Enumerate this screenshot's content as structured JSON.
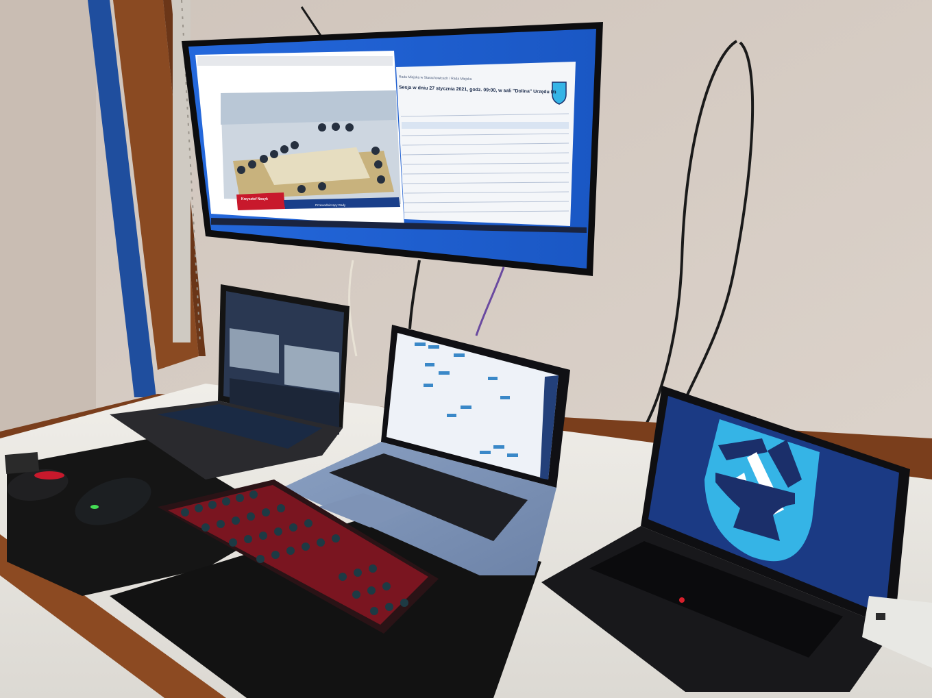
{
  "scene": {
    "description_tags": [
      "desk",
      "monitor",
      "laptop",
      "keyboard",
      "mouse",
      "coat-of-arms"
    ],
    "colors": {
      "wall": "#d9cfc7",
      "desk": "#e9e7e2",
      "screen_blue": "#1e63d6",
      "coat_of_arms_light": "#35b4e6",
      "coat_of_arms_dark": "#1b2f6a",
      "keyboard_accent": "#c8192c"
    }
  },
  "monitor": {
    "breadcrumb": "Rada Miejska w Starachowicach / Rada Miejska",
    "session_title": "Sesja w dniu 27 stycznia 2021, godz. 09:00, w sali \"Dolina\" Urzędu Miejskiego w Starachowicach",
    "lower_third_name": "Krzysztof Nosyk",
    "lower_third_role": "Przewodniczący Rady"
  }
}
